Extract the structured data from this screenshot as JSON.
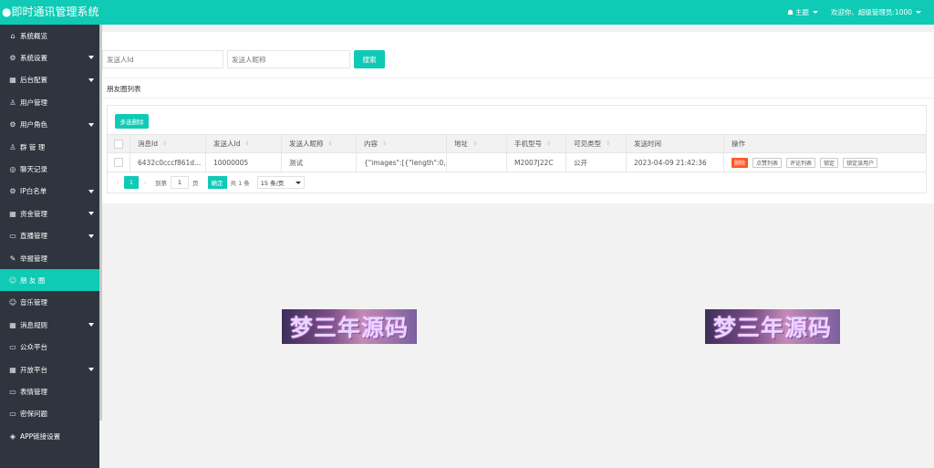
{
  "app": {
    "title": "●即时通讯管理系统"
  },
  "header": {
    "theme_label": "主题",
    "welcome": "欢迎你、超级管理员:1000"
  },
  "sidebar": {
    "items": [
      {
        "label": "系统概览",
        "icon": "home-icon",
        "glyph": "⌂",
        "caret": false,
        "active": false
      },
      {
        "label": "系统设置",
        "icon": "gear-icon",
        "glyph": "⚙",
        "caret": true,
        "active": false
      },
      {
        "label": "后台配置",
        "icon": "calendar-icon",
        "glyph": "▦",
        "caret": true,
        "active": false
      },
      {
        "label": "用户管理",
        "icon": "user-icon",
        "glyph": "♙",
        "caret": false,
        "active": false
      },
      {
        "label": "用户角色",
        "icon": "gear-icon",
        "glyph": "⚙",
        "caret": true,
        "active": false
      },
      {
        "label": "群 管 理",
        "icon": "group-icon",
        "glyph": "♙",
        "caret": false,
        "active": false
      },
      {
        "label": "聊天记录",
        "icon": "eye-icon",
        "glyph": "◎",
        "caret": false,
        "active": false
      },
      {
        "label": "IP白名单",
        "icon": "gear-icon",
        "glyph": "⚙",
        "caret": true,
        "active": false
      },
      {
        "label": "资金管理",
        "icon": "calendar-icon",
        "glyph": "▦",
        "caret": true,
        "active": false
      },
      {
        "label": "直播管理",
        "icon": "video-icon",
        "glyph": "▭",
        "caret": true,
        "active": false
      },
      {
        "label": "举报管理",
        "icon": "edit-icon",
        "glyph": "✎",
        "caret": false,
        "active": false
      },
      {
        "label": "朋 友 圈",
        "icon": "smile-icon",
        "glyph": "☺",
        "caret": false,
        "active": true
      },
      {
        "label": "音乐管理",
        "icon": "smile-icon",
        "glyph": "☺",
        "caret": false,
        "active": false
      },
      {
        "label": "消息规则",
        "icon": "calendar-icon",
        "glyph": "▦",
        "caret": true,
        "active": false
      },
      {
        "label": "公众平台",
        "icon": "monitor-icon",
        "glyph": "▭",
        "caret": false,
        "active": false
      },
      {
        "label": "开放平台",
        "icon": "calendar-icon",
        "glyph": "▦",
        "caret": true,
        "active": false
      },
      {
        "label": "表情管理",
        "icon": "keyboard-icon",
        "glyph": "▭",
        "caret": false,
        "active": false
      },
      {
        "label": "密保问题",
        "icon": "keyboard-icon",
        "glyph": "▭",
        "caret": false,
        "active": false
      },
      {
        "label": "APP链接设置",
        "icon": "layers-icon",
        "glyph": "◈",
        "caret": false,
        "active": false
      }
    ]
  },
  "search": {
    "sender_id_placeholder": "发送人Id",
    "sender_nick_placeholder": "发送人昵称",
    "search_label": "搜索"
  },
  "section": {
    "title": "朋友圈列表"
  },
  "toolbar": {
    "batch_delete_label": "多选删除"
  },
  "table": {
    "columns": [
      "消息Id",
      "发送人Id",
      "发送人昵称",
      "内容",
      "地址",
      "手机型号",
      "可见类型",
      "发送时间",
      "操作"
    ],
    "row": {
      "msg_id": "6432c0cccf861d...",
      "sender_id": "10000005",
      "sender_nick": "测试",
      "content": "{\"images\":[{\"length\":0,...",
      "address": "",
      "phone_model": "M2007J22C",
      "visibility": "公开",
      "send_time": "2023-04-09 21:42:36"
    },
    "actions": [
      "删除",
      "点赞列表",
      "评论列表",
      "锁定",
      "锁定该用户"
    ]
  },
  "pagination": {
    "current_page": "1",
    "goto_label": "到第",
    "page_input": "1",
    "page_unit": "页",
    "confirm_label": "确定",
    "total_label": "共 1 条",
    "page_size": "15 条/页"
  },
  "watermark": {
    "text": "梦三年源码"
  }
}
